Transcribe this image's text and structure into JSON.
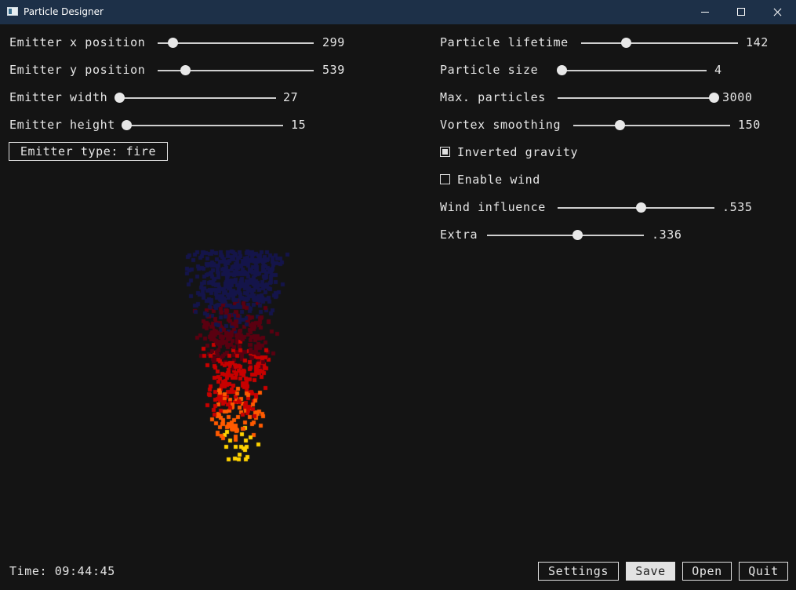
{
  "window": {
    "title": "Particle Designer"
  },
  "left_controls": [
    {
      "label": "Emitter x position",
      "value": "299",
      "fraction": 0.1
    },
    {
      "label": "Emitter y position",
      "value": "539",
      "fraction": 0.18
    },
    {
      "label": "Emitter width",
      "value": "27",
      "fraction": 0.0
    },
    {
      "label": "Emitter height",
      "value": "15",
      "fraction": 0.0
    }
  ],
  "emitter_type_button": "Emitter type: fire",
  "right_controls": [
    {
      "label": "Particle lifetime",
      "value": "142",
      "fraction": 0.29
    },
    {
      "label": "Particle size",
      "value": "4",
      "fraction": 0.03
    },
    {
      "label": "Max. particles",
      "value": "3000",
      "fraction": 1.0
    },
    {
      "label": "Vortex smoothing",
      "value": "150",
      "fraction": 0.3
    }
  ],
  "inverted_gravity": {
    "label": "Inverted gravity",
    "checked": true
  },
  "enable_wind": {
    "label": "Enable wind",
    "checked": false
  },
  "wind_influence": {
    "label": "Wind influence",
    "value": ".535",
    "fraction": 0.535
  },
  "extra": {
    "label": "Extra",
    "value": ".336",
    "fraction": 0.58
  },
  "status": {
    "time": "Time: 09:44:45"
  },
  "buttons": {
    "settings": "Settings",
    "save": "Save",
    "open": "Open",
    "quit": "Quit"
  },
  "colors": {
    "background": "#141414",
    "titlebar": "#1d3048",
    "particle_yellow": "#ffd200",
    "particle_orange": "#ff5a00",
    "particle_red": "#c80000",
    "particle_dark_red": "#5a0010",
    "particle_navy": "#14144a"
  }
}
